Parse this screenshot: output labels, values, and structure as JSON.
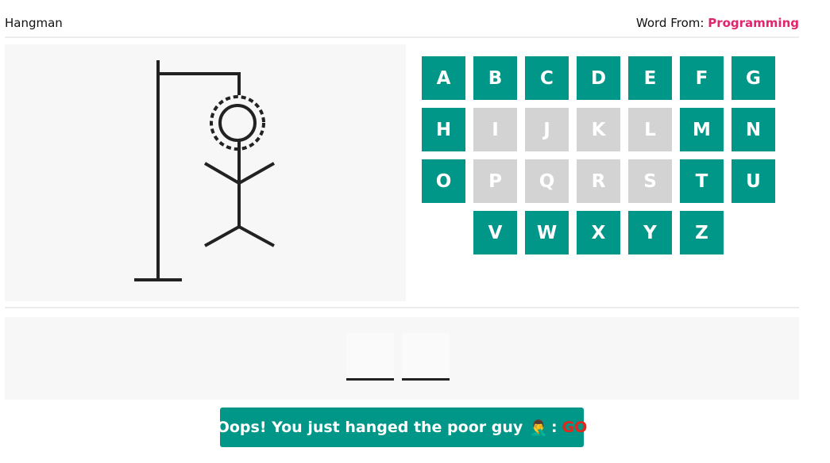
{
  "header": {
    "title": "Hangman",
    "word_from_label": "Word From:",
    "category": "Programming"
  },
  "colors": {
    "key_active": "#009688",
    "key_used": "#d3d3d3",
    "category": "#e0256e",
    "go": "#e8251a"
  },
  "gallows": {
    "figure": "hanged-stick-figure",
    "head_icon": "dashed-ring-head"
  },
  "keyboard": {
    "keys": [
      {
        "letter": "A",
        "state": "active"
      },
      {
        "letter": "B",
        "state": "active"
      },
      {
        "letter": "C",
        "state": "active"
      },
      {
        "letter": "D",
        "state": "active"
      },
      {
        "letter": "E",
        "state": "active"
      },
      {
        "letter": "F",
        "state": "active"
      },
      {
        "letter": "G",
        "state": "active"
      },
      {
        "letter": "H",
        "state": "active"
      },
      {
        "letter": "I",
        "state": "used"
      },
      {
        "letter": "J",
        "state": "used"
      },
      {
        "letter": "K",
        "state": "used"
      },
      {
        "letter": "L",
        "state": "used"
      },
      {
        "letter": "M",
        "state": "active"
      },
      {
        "letter": "N",
        "state": "active"
      },
      {
        "letter": "O",
        "state": "active"
      },
      {
        "letter": "P",
        "state": "used"
      },
      {
        "letter": "Q",
        "state": "used"
      },
      {
        "letter": "R",
        "state": "used"
      },
      {
        "letter": "S",
        "state": "used"
      },
      {
        "letter": "T",
        "state": "active"
      },
      {
        "letter": "U",
        "state": "active"
      },
      {
        "letter": "V",
        "state": "active"
      },
      {
        "letter": "W",
        "state": "active"
      },
      {
        "letter": "X",
        "state": "active"
      },
      {
        "letter": "Y",
        "state": "active"
      },
      {
        "letter": "Z",
        "state": "active"
      }
    ]
  },
  "word": {
    "slots": [
      "",
      ""
    ]
  },
  "message": {
    "text": "Oops! You just hanged the poor guy",
    "emoji": "🤦‍♂️",
    "separator": ":",
    "go_label": "GO"
  }
}
